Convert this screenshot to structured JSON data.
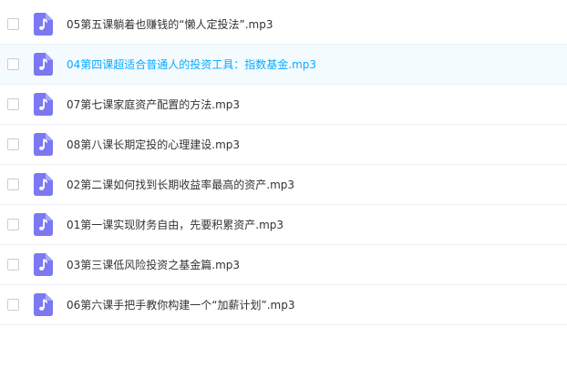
{
  "accent_color": "#09aaff",
  "file_icon": {
    "name": "audio-file-icon",
    "color": "#7b78f2"
  },
  "files": [
    {
      "name": "05第五课躺着也赚钱的“懒人定投法”.mp3",
      "highlighted": false,
      "checked": false
    },
    {
      "name": "04第四课超适合普通人的投资工具：指数基金.mp3",
      "highlighted": true,
      "checked": false
    },
    {
      "name": "07第七课家庭资产配置的方法.mp3",
      "highlighted": false,
      "checked": false
    },
    {
      "name": "08第八课长期定投的心理建设.mp3",
      "highlighted": false,
      "checked": false
    },
    {
      "name": "02第二课如何找到长期收益率最高的资产.mp3",
      "highlighted": false,
      "checked": false
    },
    {
      "name": "01第一课实现财务自由，先要积累资产.mp3",
      "highlighted": false,
      "checked": false
    },
    {
      "name": "03第三课低风险投资之基金篇.mp3",
      "highlighted": false,
      "checked": false
    },
    {
      "name": "06第六课手把手教你构建一个“加薪计划”.mp3",
      "highlighted": false,
      "checked": false
    }
  ]
}
